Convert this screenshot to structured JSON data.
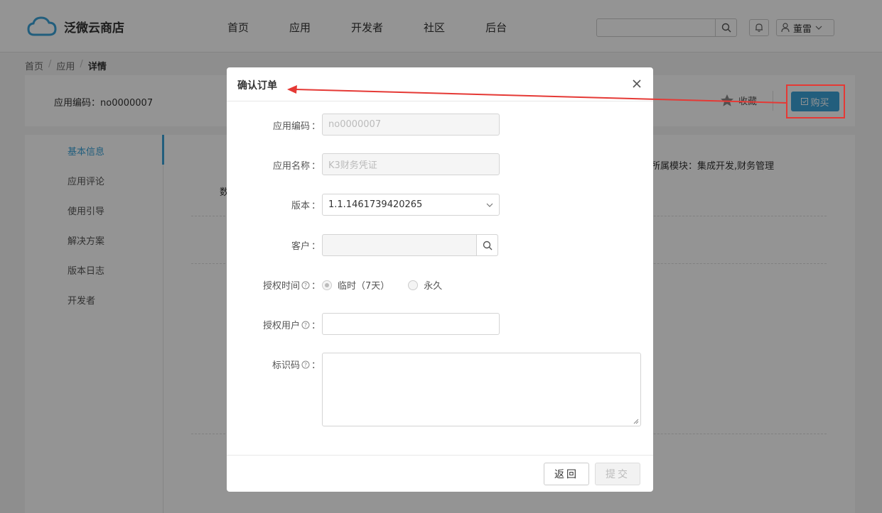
{
  "header": {
    "logo_text": "泛微云商店",
    "nav": [
      "首页",
      "应用",
      "开发者",
      "社区",
      "后台"
    ],
    "search_placeholder": "",
    "user_name": "董雷"
  },
  "breadcrumb": [
    "首页",
    "应用",
    "详情"
  ],
  "info_bar": {
    "app_code_label": "应用编码：no0000007",
    "favorite_label": "收藏",
    "buy_label": "购买"
  },
  "sidebar": {
    "items": [
      "基本信息",
      "应用评论",
      "使用引导",
      "解决方案",
      "版本日志",
      "开发者"
    ]
  },
  "content": {
    "module_text": "所属模块：集成开发,财务管理",
    "fragment_text": "数"
  },
  "modal": {
    "title": "确认订单",
    "fields": {
      "app_code": {
        "label": "应用编码",
        "value": "no0000007"
      },
      "app_name": {
        "label": "应用名称",
        "value": "K3财务凭证"
      },
      "version": {
        "label": "版本",
        "value": "1.1.1461739420265"
      },
      "customer": {
        "label": "客户",
        "value": ""
      },
      "auth_time": {
        "label": "授权时间",
        "options": [
          "临时（7天）",
          "永久"
        ],
        "selected": "临时（7天）"
      },
      "auth_users": {
        "label": "授权用户",
        "value": ""
      },
      "id_code": {
        "label": "标识码",
        "value": ""
      }
    },
    "back_label": "返回",
    "submit_label": "提交"
  },
  "colors": {
    "accent": "#3ba3d8",
    "highlight": "#e53935"
  }
}
